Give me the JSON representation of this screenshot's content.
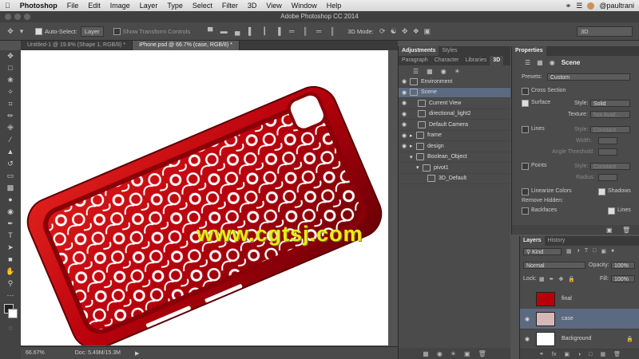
{
  "menubar": {
    "apple": "",
    "app_name": "Photoshop",
    "items": [
      "File",
      "Edit",
      "Image",
      "Layer",
      "Type",
      "Select",
      "Filter",
      "3D",
      "View",
      "Window",
      "Help"
    ],
    "user": "@paultrani"
  },
  "window": {
    "title": "Adobe Photoshop CC 2014"
  },
  "options_bar": {
    "auto_select_label": "Auto-Select:",
    "auto_select_value": "Layer",
    "show_transform_label": "Show Transform Controls",
    "mode_label": "3D Mode:",
    "workspace_value": "3D"
  },
  "document_tabs": [
    {
      "label": "Untitled-1 @ 19.8% (Shape 1, RGB/8) *",
      "active": false
    },
    {
      "label": "iPhone.psd @ 66.7% (case, RGB/8) *",
      "active": true
    }
  ],
  "status": {
    "zoom": "66.67%",
    "doc": "Doc: 5.49M/15.3M"
  },
  "watermark": "www.cgtsj.com",
  "panel_3d": {
    "tabs": [
      "Adjustments",
      "Styles"
    ],
    "tabs2": [
      "Paragraph",
      "Character",
      "Libraries",
      "3D"
    ],
    "rows": [
      {
        "label": "Environment",
        "indent": 0,
        "selected": false
      },
      {
        "label": "Scene",
        "indent": 0,
        "selected": true
      },
      {
        "label": "Current View",
        "indent": 1,
        "selected": false
      },
      {
        "label": "directional_light2",
        "indent": 1,
        "selected": false
      },
      {
        "label": "Default Camera",
        "indent": 1,
        "selected": false
      },
      {
        "label": "frame",
        "indent": 0,
        "selected": false
      },
      {
        "label": "design",
        "indent": 0,
        "selected": false
      },
      {
        "label": "Boolean_Object",
        "indent": 0,
        "selected": false
      },
      {
        "label": "pivot1",
        "indent": 1,
        "selected": false
      },
      {
        "label": "3D_Default",
        "indent": 2,
        "selected": false
      }
    ]
  },
  "properties": {
    "tab": "Properties",
    "header": "Scene",
    "presets_label": "Presets:",
    "presets_value": "Custom",
    "cross_section": "Cross Section",
    "surface": "Surface",
    "style_label": "Style:",
    "surface_style": "Solid",
    "texture_label": "Texture:",
    "texture_value": "Not Avail...",
    "lines": "Lines",
    "lines_style": "Constant",
    "width_label": "Width:",
    "angle_label": "Angle Threshold:",
    "points": "Points",
    "points_style": "Constant",
    "radius_label": "Radius:",
    "linearize": "Linearize Colors",
    "shadows": "Shadows",
    "remove_hidden": "Remove Hidden:",
    "backfaces": "Backfaces",
    "lines2": "Lines"
  },
  "layers": {
    "tabs": [
      "Layers",
      "History"
    ],
    "kind": "Kind",
    "blend": "Normal",
    "opacity_label": "Opacity:",
    "opacity": "100%",
    "lock_label": "Lock:",
    "fill_label": "Fill:",
    "fill": "100%",
    "items": [
      {
        "name": "final",
        "selected": false
      },
      {
        "name": "case",
        "selected": true
      },
      {
        "name": "Background",
        "selected": false
      }
    ]
  },
  "colors": {
    "case_red": "#b8000c",
    "selection": "#5b6a80",
    "watermark": "#e8ee1a"
  }
}
